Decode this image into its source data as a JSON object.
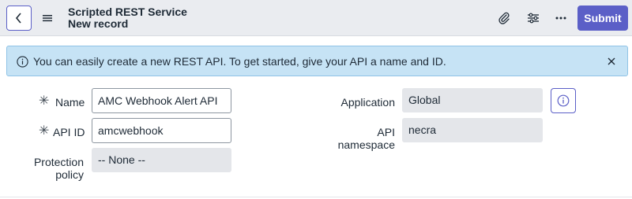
{
  "header": {
    "title_line1": "Scripted REST Service",
    "title_line2": "New record",
    "submit_label": "Submit"
  },
  "banner": {
    "message": "You can easily create a new REST API. To get started, give your API a name and ID."
  },
  "form": {
    "name": {
      "label": "Name",
      "value": "AMC Webhook Alert API",
      "required": true
    },
    "api_id": {
      "label": "API ID",
      "value": "amcwebhook",
      "required": true
    },
    "protection_policy": {
      "label_line1": "Protection",
      "label_line2": "policy",
      "value": "-- None --"
    },
    "application": {
      "label": "Application",
      "value": "Global"
    },
    "api_namespace": {
      "label_line1": "API",
      "label_line2": "namespace",
      "value": "necra"
    }
  },
  "colors": {
    "accent": "#5b5fc7",
    "header_bg": "#eaecf0",
    "banner_bg": "#c6e3f5",
    "readonly_bg": "#e4e6ea"
  },
  "icons": [
    "back-icon",
    "hamburger-menu-icon",
    "paperclip-icon",
    "sliders-icon",
    "more-icon",
    "info-icon",
    "close-icon"
  ]
}
